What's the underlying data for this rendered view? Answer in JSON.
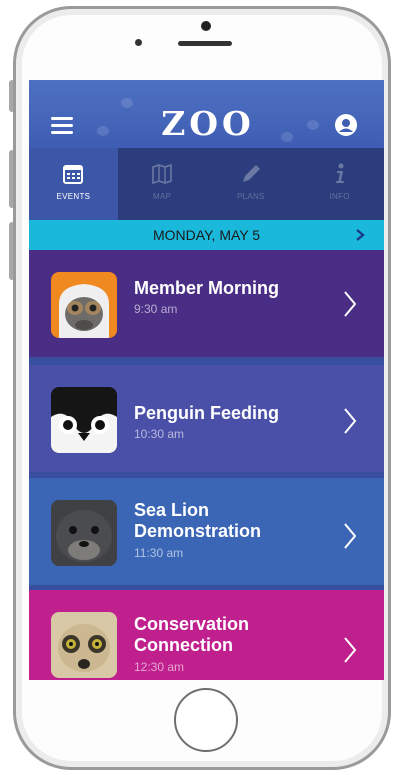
{
  "app": {
    "logo_text": "ZOO",
    "colors": {
      "topbar": "#4a6bbd",
      "tabbar": "#2b3d7c",
      "datebar": "#1ab9dc",
      "event_1": "#4a2e86",
      "event_2": "#4a4fa8",
      "event_3": "#3b66b6",
      "event_4": "#c0208d"
    }
  },
  "tabs": [
    {
      "label": "EVENTS",
      "icon": "calendar-icon",
      "active": true
    },
    {
      "label": "MAP",
      "icon": "map-icon",
      "active": false
    },
    {
      "label": "PLANS",
      "icon": "pencil-icon",
      "active": false
    },
    {
      "label": "INFO",
      "icon": "info-icon",
      "active": false
    }
  ],
  "date_bar": {
    "date": "MONDAY, MAY 5"
  },
  "events": [
    {
      "title": "Member Morning",
      "time": "9:30 am",
      "animal": "orangutan-icon"
    },
    {
      "title": "Penguin Feeding",
      "time": "10:30 am",
      "animal": "penguin-icon"
    },
    {
      "title": "Sea Lion Demonstration",
      "time": "11:30 am",
      "animal": "sea-lion-icon"
    },
    {
      "title": "Conservation Connection",
      "time": "12:30 am",
      "animal": "meerkat-icon"
    }
  ]
}
